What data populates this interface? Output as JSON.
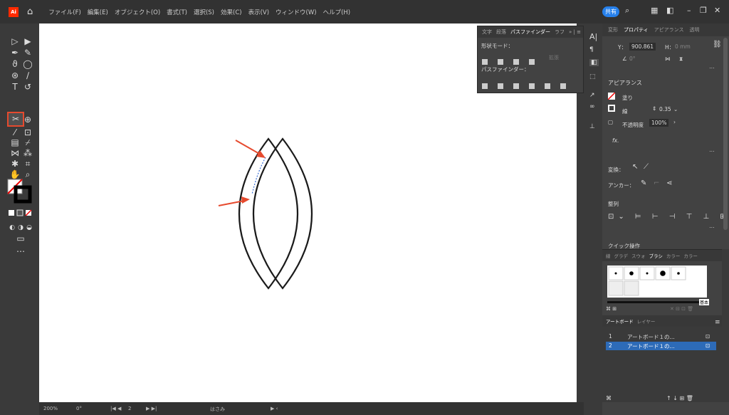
{
  "app": {
    "logo": "Ai"
  },
  "menu": {
    "items": [
      "ファイル(F)",
      "編集(E)",
      "オブジェクト(O)",
      "書式(T)",
      "選択(S)",
      "効果(C)",
      "表示(V)",
      "ウィンドウ(W)",
      "ヘルプ(H)"
    ],
    "share_label": "共有"
  },
  "pathfinder_panel": {
    "tabs": [
      "文字",
      "段落",
      "パスファインダー",
      "ラフ"
    ],
    "shape_modes_label": "形状モード：",
    "expand_label": "拡張",
    "pathfinders_label": "パスファインダー："
  },
  "properties_panel": {
    "tabs": [
      "変形",
      "プロパティ",
      "アピアランス",
      "透明"
    ],
    "y_label": "Y：",
    "y_value": "900.861",
    "h_label": "H：",
    "h_value": "0 mm",
    "angle_value": "0°",
    "appearance_title": "アピアランス",
    "fill_label": "塗り",
    "stroke_label": "線",
    "stroke_value": "0.35",
    "opacity_label": "不透明度",
    "opacity_value": "100%",
    "fx_label": "fx.",
    "transform_label": "変換：",
    "anchor_label": "アンカー：",
    "align_label": "整列",
    "quick_actions_label": "クイック操作"
  },
  "brush_panel": {
    "tabs": [
      "線",
      "グラデ",
      "スウォ",
      "ブラシ",
      "カラー",
      "カラー"
    ],
    "basic_label": "基本"
  },
  "layers_panel": {
    "tabs": [
      "アートボード",
      "レイヤー"
    ],
    "rows": [
      {
        "num": "1",
        "name": "アートボード１の..."
      },
      {
        "num": "2",
        "name": "アートボード１の..."
      }
    ]
  },
  "status_bar": {
    "zoom": "200%",
    "rotation": "0°",
    "artboard": "2",
    "tool": "はさみ"
  },
  "colors": {
    "accent": "#2680eb",
    "annotation": "#e64a2e",
    "logo": "#ff2a00"
  }
}
